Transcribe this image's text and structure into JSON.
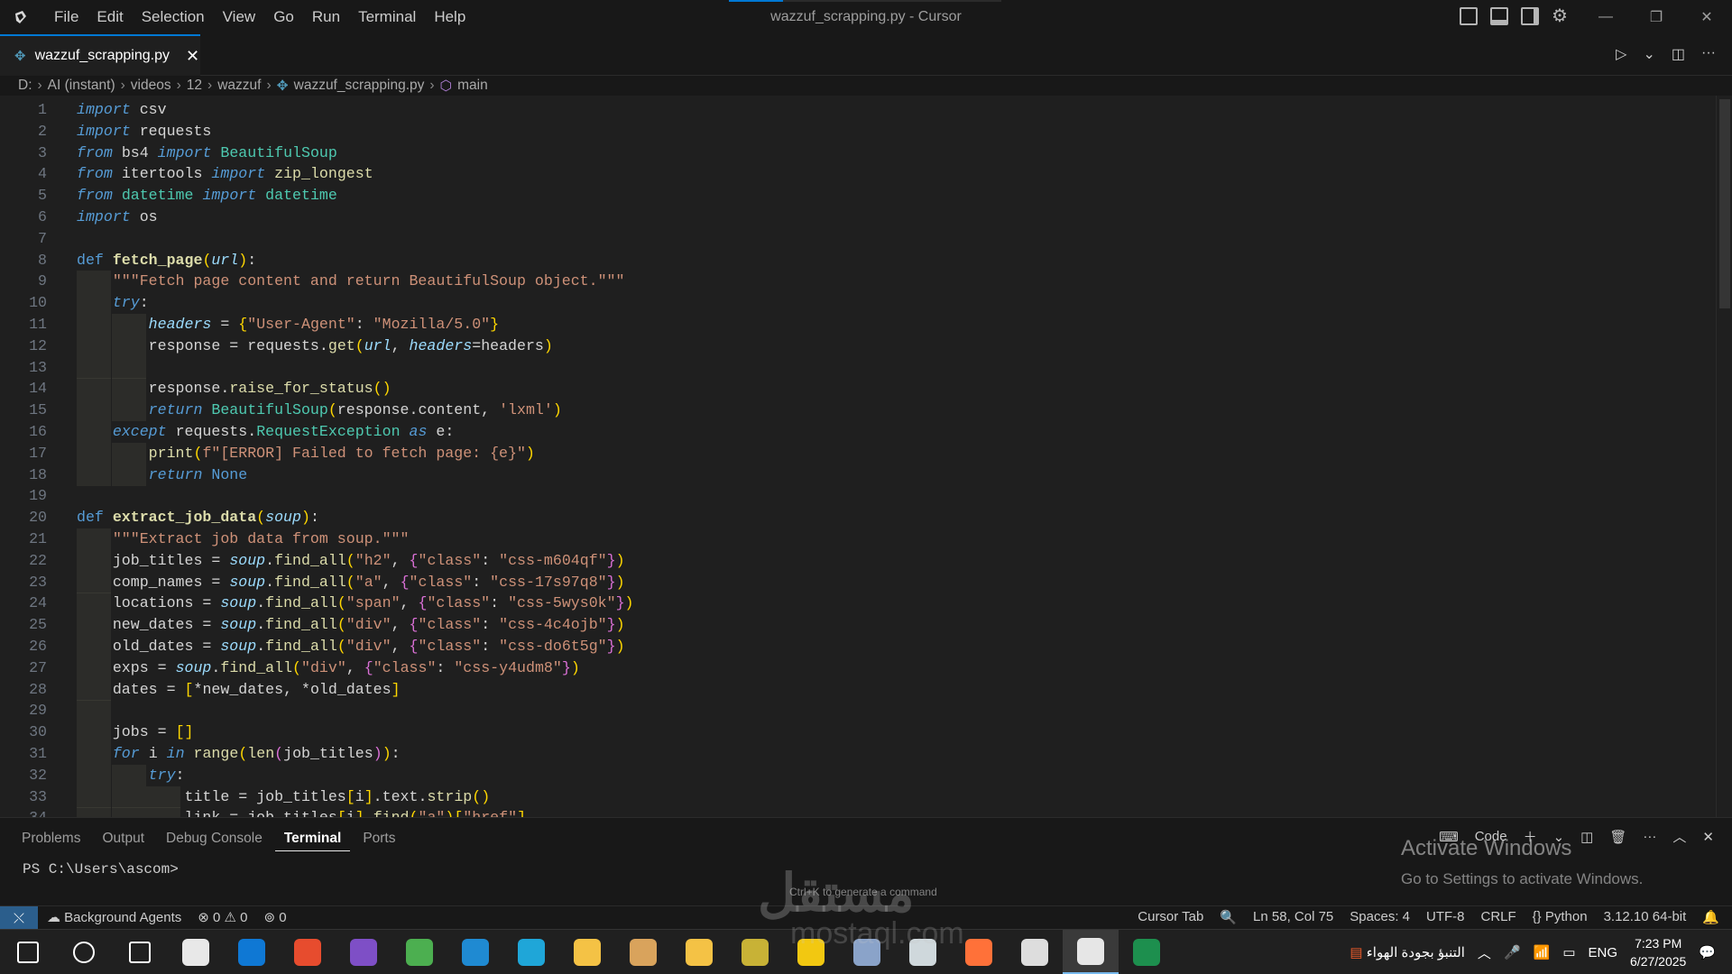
{
  "window": {
    "title": "wazzuf_scrapping.py - Cursor",
    "menu": [
      "File",
      "Edit",
      "Selection",
      "View",
      "Go",
      "Run",
      "Terminal",
      "Help"
    ]
  },
  "tab": {
    "filename": "wazzuf_scrapping.py",
    "icon": "python-file-icon"
  },
  "breadcrumb": [
    "D:",
    "AI (instant)",
    "videos",
    "12",
    "wazzuf",
    "wazzuf_scrapping.py",
    "main"
  ],
  "editor": {
    "language": "Python",
    "lines": [
      "import csv",
      "import requests",
      "from bs4 import BeautifulSoup",
      "from itertools import zip_longest",
      "from datetime import datetime",
      "import os",
      "",
      "def fetch_page(url):",
      "    \"\"\"Fetch page content and return BeautifulSoup object.\"\"\"",
      "    try:",
      "        headers = {\"User-Agent\": \"Mozilla/5.0\"}",
      "        response = requests.get(url, headers=headers)",
      "",
      "        response.raise_for_status()",
      "        return BeautifulSoup(response.content, 'lxml')",
      "    except requests.RequestException as e:",
      "        print(f\"[ERROR] Failed to fetch page: {e}\")",
      "        return None",
      "",
      "def extract_job_data(soup):",
      "    \"\"\"Extract job data from soup.\"\"\"",
      "    job_titles = soup.find_all(\"h2\", {\"class\": \"css-m604qf\"})",
      "    comp_names = soup.find_all(\"a\", {\"class\": \"css-17s97q8\"})",
      "    locations = soup.find_all(\"span\", {\"class\": \"css-5wys0k\"})",
      "    new_dates = soup.find_all(\"div\", {\"class\": \"css-4c4ojb\"})",
      "    old_dates = soup.find_all(\"div\", {\"class\": \"css-do6t5g\"})",
      "    exps = soup.find_all(\"div\", {\"class\": \"css-y4udm8\"})",
      "    dates = [*new_dates, *old_dates]",
      "",
      "    jobs = []",
      "    for i in range(len(job_titles)):",
      "        try:",
      "            title = job_titles[i].text.strip()",
      "            link = job_titles[i].find(\"a\")[\"href\"]"
    ]
  },
  "panel": {
    "tabs": [
      "Problems",
      "Output",
      "Debug Console",
      "Terminal",
      "Ports"
    ],
    "active_tab": "Terminal",
    "terminal_name": "Code",
    "prompt": "PS C:\\Users\\ascom>",
    "hint": "Ctrl+K to generate a command"
  },
  "activation": {
    "title": "Activate Windows",
    "subtitle": "Go to Settings to activate Windows."
  },
  "watermark": {
    "arabic": "مستقل",
    "latin": "mostaql.com"
  },
  "status": {
    "agents": "Background Agents",
    "errors": "0",
    "warnings": "0",
    "ports": "0",
    "cursor_tab": "Cursor Tab",
    "position": "Ln 58, Col 75",
    "spaces": "Spaces: 4",
    "encoding": "UTF-8",
    "eol": "CRLF",
    "language": "Python",
    "interpreter": "3.12.10 64-bit"
  },
  "taskbar": {
    "weather": "التنبؤ بجودة الهواء",
    "lang": "ENG",
    "time": "7:23 PM",
    "date": "6/27/2025",
    "apps": [
      {
        "name": "windows-start-icon",
        "color": "#ffffff"
      },
      {
        "name": "search-icon",
        "color": "#ffffff"
      },
      {
        "name": "task-view-icon",
        "color": "#ffffff"
      },
      {
        "name": "store-icon",
        "color": "#e8e8e8"
      },
      {
        "name": "outlook-icon",
        "color": "#0f78d4"
      },
      {
        "name": "office-icon",
        "color": "#e74c2e"
      },
      {
        "name": "visual-studio-icon",
        "color": "#7e4fc6"
      },
      {
        "name": "chrome-icon",
        "color": "#4caf50"
      },
      {
        "name": "vscode-icon",
        "color": "#1f8ad2"
      },
      {
        "name": "edge-icon",
        "color": "#1fa6d8"
      },
      {
        "name": "photos-icon",
        "color": "#f4c245"
      },
      {
        "name": "game-icon",
        "color": "#d9a35c"
      },
      {
        "name": "file-explorer-icon",
        "color": "#f4c245"
      },
      {
        "name": "tools-icon",
        "color": "#c8b236"
      },
      {
        "name": "power-bi-icon",
        "color": "#f2c811"
      },
      {
        "name": "copilot-icon",
        "color": "#8aa3c9"
      },
      {
        "name": "bot-icon",
        "color": "#cfd8dc"
      },
      {
        "name": "firefox-icon",
        "color": "#ff7139"
      },
      {
        "name": "obs-icon",
        "color": "#dddddd"
      },
      {
        "name": "cursor-icon",
        "color": "#e6e6e6"
      },
      {
        "name": "excel-icon",
        "color": "#1d8f4e"
      }
    ]
  }
}
